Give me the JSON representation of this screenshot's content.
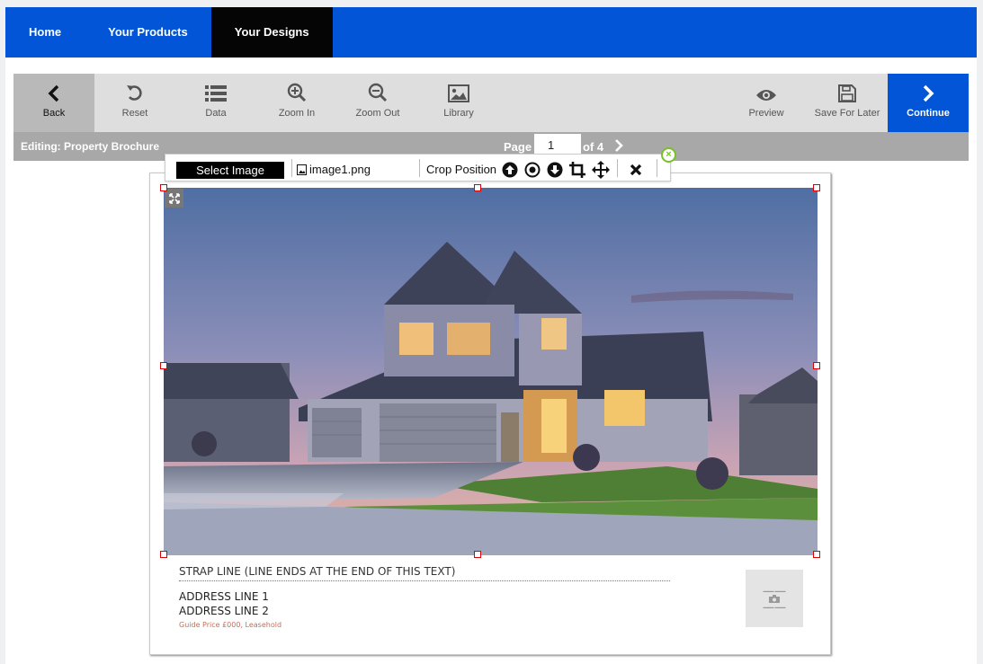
{
  "nav": {
    "items": [
      {
        "label": "Home"
      },
      {
        "label": "Your Products"
      },
      {
        "label": "Your Designs"
      }
    ],
    "active_color": "#050505",
    "bar_color": "#0255d6"
  },
  "toolbar": {
    "back": "Back",
    "reset": "Reset",
    "data": "Data",
    "zoom_in": "Zoom In",
    "zoom_out": "Zoom Out",
    "library": "Library",
    "preview": "Preview",
    "save_later": "Save For Later",
    "continue": "Continue"
  },
  "status": {
    "editing": "Editing: Property Brochure",
    "page_label": "Page",
    "page_value": "1",
    "page_of": "of 4"
  },
  "image_toolbar": {
    "select_image": "Select Image",
    "file_name": "image1.png",
    "crop_position": "Crop Position",
    "icons": [
      "arrow-up-circle-icon",
      "center-circle-icon",
      "arrow-down-circle-icon",
      "crop-icon",
      "move-icon",
      "close-icon"
    ]
  },
  "document": {
    "strap_line": "STRAP LINE (LINE ENDS AT THE END OF THIS TEXT)",
    "address_1": "ADDRESS LINE 1",
    "address_2": "ADDRESS LINE 2",
    "guide_price": "Guide Price £000, Leasehold",
    "photo_subject": "house at dusk"
  }
}
